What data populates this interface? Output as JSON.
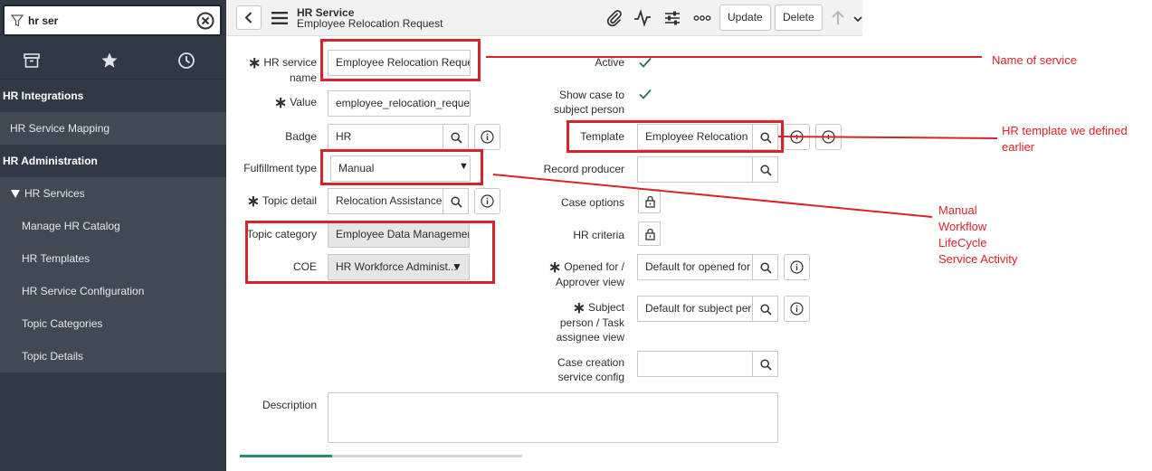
{
  "sidebar": {
    "filter_value": "hr ser",
    "sections": [
      {
        "label": "HR Integrations"
      },
      {
        "label": "HR Service Mapping"
      },
      {
        "label": "HR Administration"
      },
      {
        "label": "HR Services"
      },
      {
        "label": "Manage HR Catalog"
      },
      {
        "label": "HR Templates"
      },
      {
        "label": "HR Service Configuration"
      },
      {
        "label": "Topic Categories"
      },
      {
        "label": "Topic Details"
      }
    ],
    "tab_icons": [
      "archive-icon",
      "star-icon",
      "clock-icon"
    ]
  },
  "header": {
    "record_type": "HR Service",
    "record_name": "Employee Relocation Request",
    "update_label": "Update",
    "delete_label": "Delete",
    "icons": [
      "paperclip-icon",
      "activity-icon",
      "sliders-icon",
      "more-icon",
      "arrow-up-icon"
    ]
  },
  "form": {
    "hr_service_name_label": "HR service name",
    "hr_service_name_value": "Employee Relocation Request",
    "value_label": "Value",
    "value_value": "employee_relocation_request",
    "badge_label": "Badge",
    "badge_value": "HR",
    "fulfillment_type_label": "Fulfillment type",
    "fulfillment_type_value": "Manual",
    "topic_detail_label": "Topic detail",
    "topic_detail_value": "Relocation Assistance",
    "topic_category_label": "Topic category",
    "topic_category_value": "Employee Data Management",
    "coe_label": "COE",
    "coe_value": "HR Workforce Administ...",
    "description_label": "Description",
    "description_value": "",
    "active_label": "Active",
    "active_checked": true,
    "show_case_label": "Show case to subject person",
    "show_case_checked": true,
    "template_label": "Template",
    "template_value": "Employee Relocation",
    "record_producer_label": "Record producer",
    "record_producer_value": "",
    "case_options_label": "Case options",
    "hr_criteria_label": "HR criteria",
    "opened_for_label": "Opened for / Approver view",
    "opened_for_value": "Default for opened for",
    "subject_person_label": "Subject person / Task assignee view",
    "subject_person_value": "Default for subject person",
    "case_creation_label": "Case creation service config",
    "case_creation_value": ""
  },
  "annotations": {
    "name_of_service": "Name of service",
    "hr_template": "HR template we defined earlier",
    "fulfillment_options": [
      "Manual",
      "Workflow",
      "LifeCycle",
      "Service Activity"
    ]
  },
  "colors": {
    "sidebar_bg": "#303a46",
    "sidebar_item_bg": "#3f4a55",
    "annotation_red": "#d9232a",
    "checkbox_green": "#278efc"
  }
}
